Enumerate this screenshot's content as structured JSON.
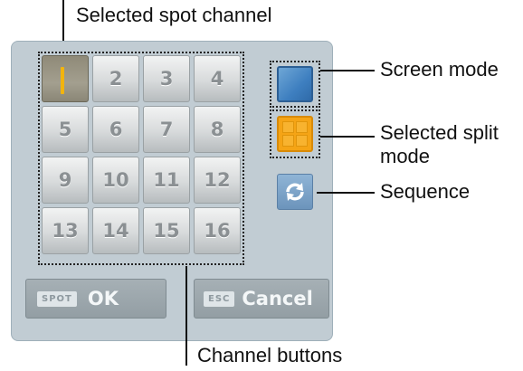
{
  "annotations": {
    "selected_spot_channel": "Selected spot channel",
    "screen_mode": "Screen mode",
    "selected_split_mode_line1": "Selected split",
    "selected_split_mode_line2": "mode",
    "sequence": "Sequence",
    "channel_buttons": "Channel buttons"
  },
  "channels": [
    "1",
    "2",
    "3",
    "4",
    "5",
    "6",
    "7",
    "8",
    "9",
    "10",
    "11",
    "12",
    "13",
    "14",
    "15",
    "16"
  ],
  "selected_channel": "1",
  "mode_buttons": {
    "screen_mode_icon": "single-screen-icon",
    "split_mode_icon": "quad-split-icon",
    "sequence_icon": "sequence-refresh-icon"
  },
  "footer": {
    "ok_key": "SPOT",
    "ok_label": "OK",
    "cancel_key": "ESC",
    "cancel_label": "Cancel"
  },
  "colors": {
    "panel": "#c1ccd3",
    "selected_number": "#f2b40e",
    "screen_mode": "#3e7fc0",
    "split_mode": "#f5a415",
    "sequence": "#6c94bb"
  }
}
